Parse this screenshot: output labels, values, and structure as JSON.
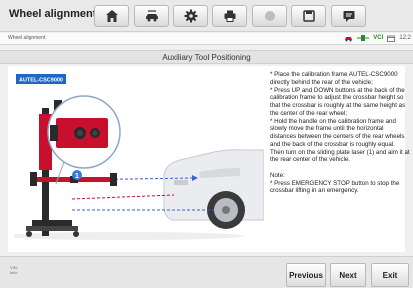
{
  "app": {
    "title": "Wheel alignment"
  },
  "toolbar": {
    "buttons": [
      {
        "name": "home-button",
        "icon": "home-icon"
      },
      {
        "name": "vehicle-lift-button",
        "icon": "car-lift-icon"
      },
      {
        "name": "settings-button",
        "icon": "gear-icon"
      },
      {
        "name": "print-button",
        "icon": "printer-icon"
      },
      {
        "name": "disabled-button",
        "icon": "circle-icon"
      },
      {
        "name": "save-button",
        "icon": "save-icon"
      },
      {
        "name": "message-button",
        "icon": "message-icon"
      }
    ]
  },
  "status": {
    "breadcrumb": "Wheel alignment",
    "vci": "VCI",
    "time": "12:2"
  },
  "section": {
    "title": "Auxiliary Tool Positioning"
  },
  "illustration": {
    "label": "AUTEL-CSC9000",
    "callout": "1"
  },
  "instructions": "* Place the calibration frame AUTEL-CSC9000 directly behind the rear of the vehicle;\n* Press UP and DOWN buttons at the back of the calibration frame to adjust the crossbar height so that the crossbar is roughly at the same height as the center of the rear wheel;\n* Hold the handle on the calibration frame and slowly move the frame until the horizontal distances between the centers of the rear wheels and the back of the crossbar is roughly equal. Then turn on the sliding plate laser (1) and aim it at the rear center of the vehicle.\n\nNote:\n* Press EMERGENCY STOP button to stop the crossbar lifting in an emergency.",
  "footer": {
    "info_line1": "VIN:",
    "info_line2": "Info:",
    "previous": "Previous",
    "next": "Next",
    "exit": "Exit"
  },
  "colors": {
    "accent_red": "#c8102e",
    "laser_blue": "#3b5fd8",
    "frame_dark": "#2a2a2a"
  }
}
